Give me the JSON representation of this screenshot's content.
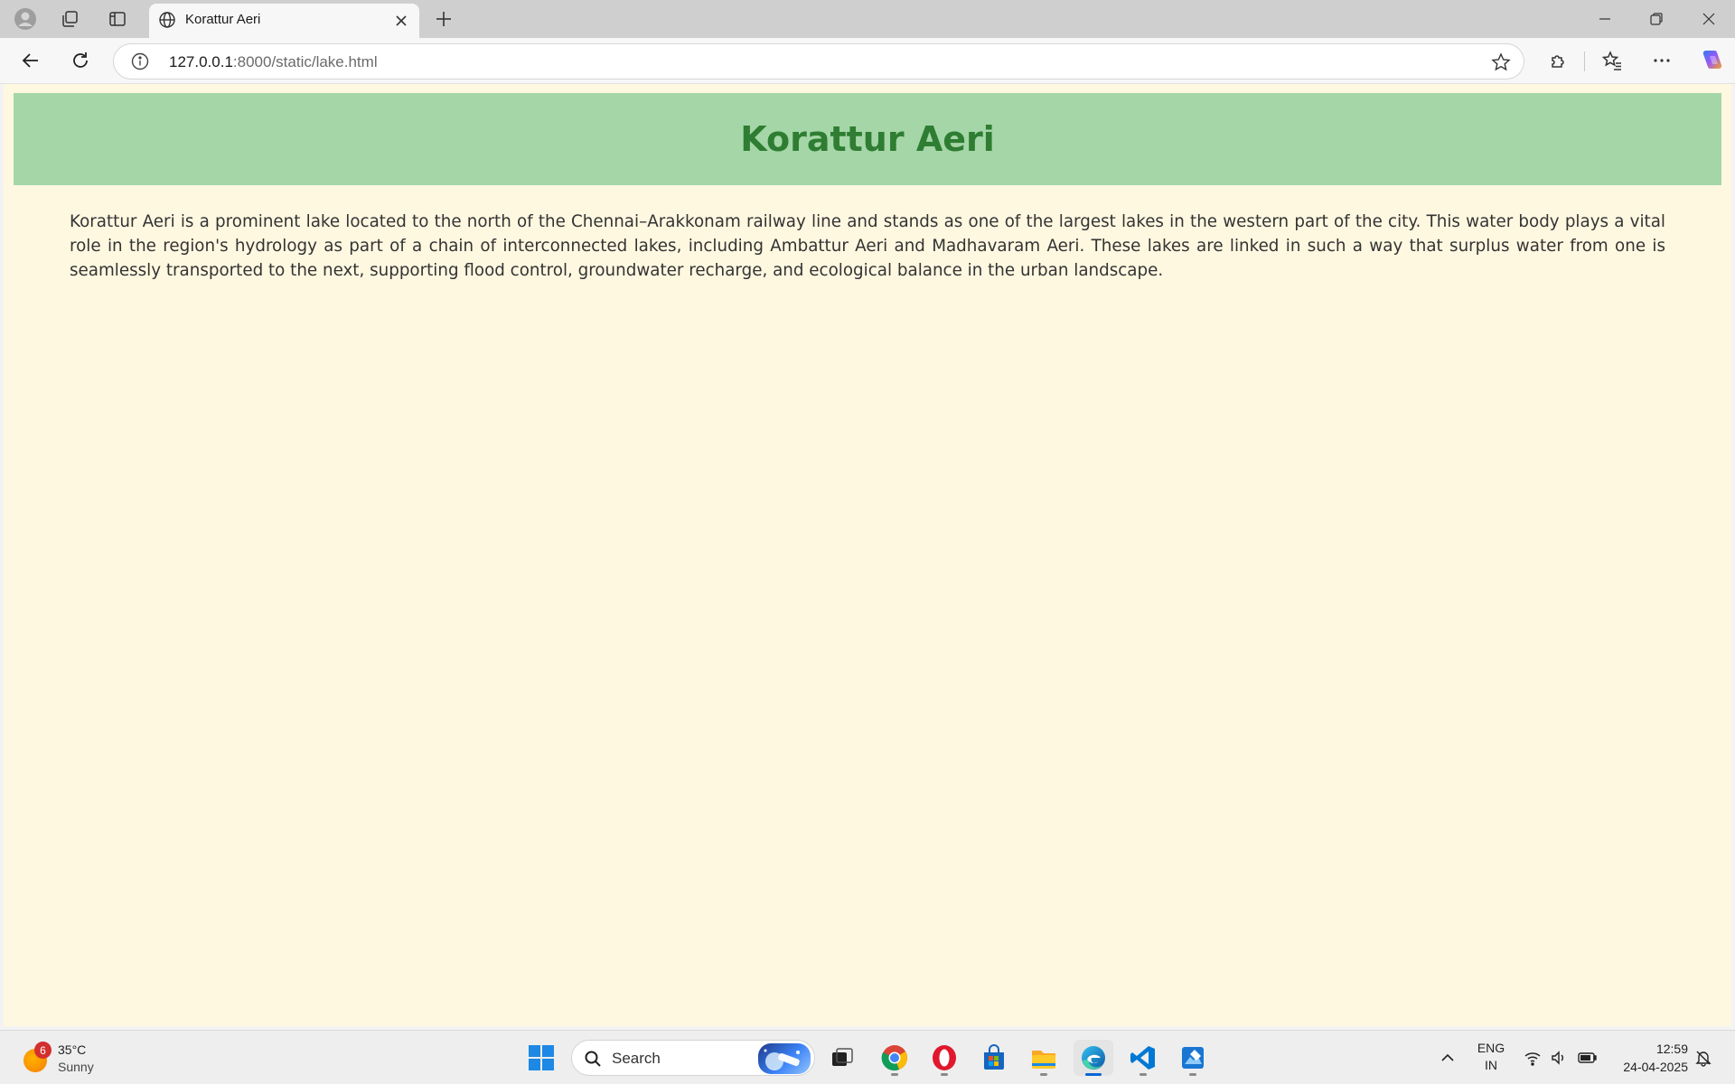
{
  "browser": {
    "tab": {
      "title": "Korattur Aeri"
    },
    "address": {
      "host": "127.0.0.1",
      "path": ":8000/static/lake.html"
    }
  },
  "page": {
    "title": "Korattur Aeri",
    "paragraph": "Korattur Aeri is a prominent lake located to the north of the Chennai–Arakkonam railway line and stands as one of the largest lakes in the western part of the city. This water body plays a vital role in the region's hydrology as part of a chain of interconnected lakes, including Ambattur Aeri and Madhavaram Aeri. These lakes are linked in such a way that surplus water from one is seamlessly transported to the next, supporting flood control, groundwater recharge, and ecological balance in the urban landscape.",
    "colors": {
      "background": "#fff8e1",
      "header_bg": "#a5d6a7",
      "title": "#2e7d32"
    }
  },
  "taskbar": {
    "weather": {
      "badge": "6",
      "temp": "35°C",
      "condition": "Sunny"
    },
    "search": {
      "label": "Search"
    },
    "apps": [
      "windows-start",
      "task-view",
      "chrome",
      "opera",
      "microsoft-store",
      "file-explorer",
      "edge",
      "vscode",
      "paint"
    ],
    "tray": {
      "lang_line1": "ENG",
      "lang_line2": "IN"
    },
    "clock": {
      "time": "12:59",
      "date": "24-04-2025"
    }
  }
}
